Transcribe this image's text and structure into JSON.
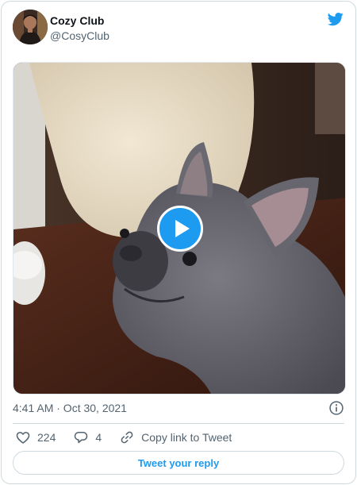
{
  "author": {
    "display_name": "Cozy Club",
    "handle": "@CosyClub",
    "avatar_icon": "profile-photo"
  },
  "brand": {
    "icon": "twitter-bird-icon",
    "color": "#1d9bf0"
  },
  "media": {
    "type": "video",
    "play_icon": "play-icon"
  },
  "meta": {
    "timestamp": "4:41 AM · Oct 30, 2021",
    "info_icon": "info-icon"
  },
  "actions": {
    "like": {
      "icon": "heart-icon",
      "count": "224"
    },
    "reply": {
      "icon": "comment-icon",
      "count": "4"
    },
    "copy_link": {
      "icon": "link-icon",
      "label": "Copy link to Tweet"
    }
  },
  "reply_button": {
    "label": "Tweet your reply"
  },
  "colors": {
    "accent": "#1d9bf0",
    "secondary_text": "#536471",
    "border": "#cfd9de"
  }
}
